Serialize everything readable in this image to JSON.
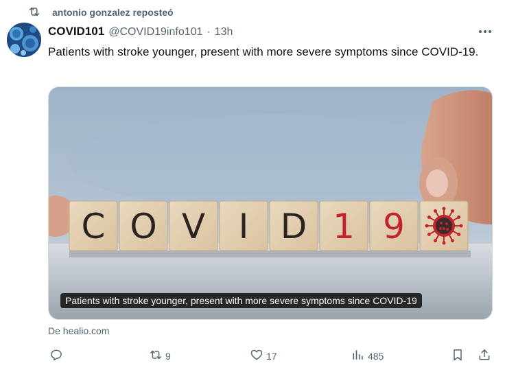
{
  "repost": {
    "icon": "repost-icon",
    "text": "antonio gonzalez reposteó"
  },
  "tweet": {
    "author_name": "COVID101",
    "author_handle": "@COVID19info101",
    "separator": "·",
    "time": "13h",
    "text": "Patients with stroke younger, present with more severe symptoms since COVID-19.",
    "more_icon": "more-icon"
  },
  "card": {
    "blocks": [
      "C",
      "O",
      "V",
      "I",
      "D",
      "1",
      "9"
    ],
    "caption": "Patients with stroke younger, present with more severe symptoms since COVID-19",
    "source": "De healio.com"
  },
  "actions": {
    "reply": {
      "icon": "reply-icon",
      "count": ""
    },
    "repost": {
      "icon": "repost-icon",
      "count": "9"
    },
    "like": {
      "icon": "heart-icon",
      "count": "17"
    },
    "views": {
      "icon": "views-icon",
      "count": "485"
    },
    "bookmark": {
      "icon": "bookmark-icon"
    },
    "share": {
      "icon": "share-icon"
    }
  },
  "colors": {
    "secondary_text": "#536471",
    "primary_text": "#0f1419",
    "virus_red": "#c0252b"
  }
}
